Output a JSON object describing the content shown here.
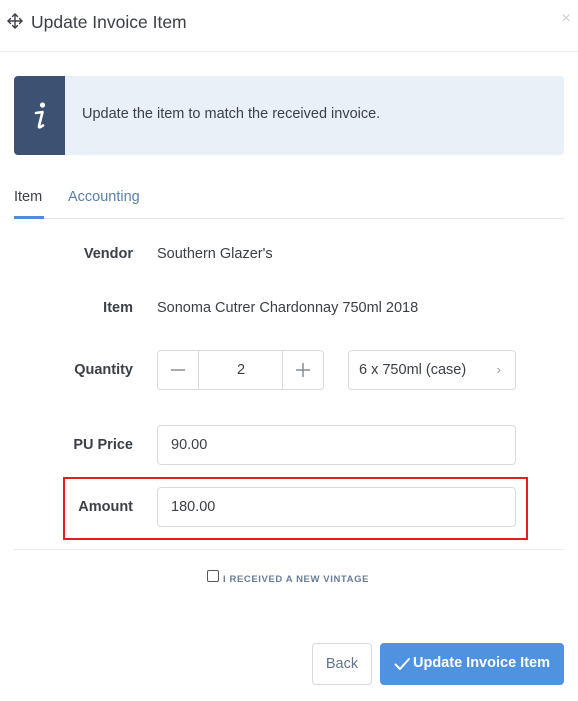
{
  "dialog": {
    "title": "Update Invoice Item",
    "close_icon": "close-icon",
    "move_icon": "move-icon"
  },
  "info": {
    "icon": "info-icon",
    "message": "Update the item to match the received invoice."
  },
  "tabs": [
    {
      "label": "Item",
      "active": true
    },
    {
      "label": "Accounting",
      "active": false
    }
  ],
  "form": {
    "vendor": {
      "label": "Vendor",
      "value": "Southern Glazer's"
    },
    "item": {
      "label": "Item",
      "value": "Sonoma Cutrer Chardonnay 750ml 2018"
    },
    "quantity": {
      "label": "Quantity",
      "value": "2",
      "unit": "6 x 750ml (case)"
    },
    "pu_price": {
      "label": "PU Price",
      "value": "90.00"
    },
    "amount": {
      "label": "Amount",
      "value": "180.00"
    },
    "vintage_checkbox": {
      "label": "I RECEIVED A NEW VINTAGE",
      "checked": false
    }
  },
  "buttons": {
    "back": "Back",
    "update": "Update Invoice Item"
  },
  "colors": {
    "accent": "#4f93e0",
    "info_side": "#3d5273",
    "highlight": "#e02020"
  }
}
